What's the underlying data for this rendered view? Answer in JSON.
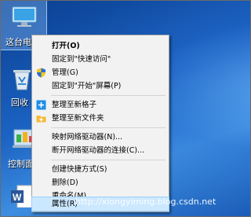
{
  "desktop": {
    "icons": [
      {
        "label": "这台电",
        "icon": "computer-icon"
      },
      {
        "label": "回收",
        "icon": "recycle-bin-icon"
      },
      {
        "label": "控制面",
        "icon": "control-panel-icon"
      },
      {
        "label": "",
        "icon": "word-document-icon"
      }
    ]
  },
  "context_menu": {
    "items": [
      {
        "label": "打开(O)",
        "bold": true
      },
      {
        "label": "固定到\"快速访问\""
      },
      {
        "label": "管理(G)",
        "icon": "shield-icon"
      },
      {
        "label": "固定到\"开始\"屏幕(P)"
      },
      {
        "label": "整理至新格子",
        "icon": "add-grid-icon"
      },
      {
        "label": "整理至新文件夹",
        "icon": "folder-icon"
      },
      {
        "label": "映射网络驱动器(N)..."
      },
      {
        "label": "断开网络驱动器的连接(C)..."
      },
      {
        "label": "创建快捷方式(S)"
      },
      {
        "label": "删除(D)"
      },
      {
        "label": "重命名(M)"
      },
      {
        "label": "属性(R)",
        "highlighted": true
      }
    ]
  },
  "watermark": "http://xiongyiming.blog.csdn.net",
  "colors": {
    "menu_bg": "#f2f2f2",
    "highlight": "#cce8ff",
    "selection_border": "#99d1ff"
  }
}
